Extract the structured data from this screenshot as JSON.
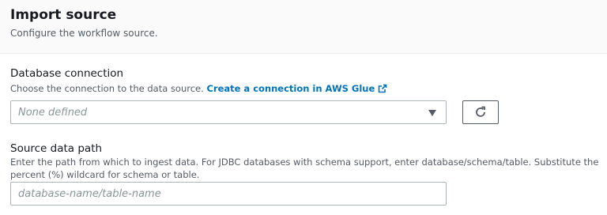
{
  "header": {
    "title": "Import source",
    "description": "Configure the workflow source."
  },
  "database_connection": {
    "label": "Database connection",
    "description": "Choose the connection to the data source.",
    "link_text": "Create a connection in AWS Glue",
    "link_icon": "external-link-icon",
    "selected_value": "None defined",
    "refresh_icon": "refresh-icon"
  },
  "source_path": {
    "label": "Source data path",
    "description": "Enter the path from which to ingest data. For JDBC databases with schema support, enter database/schema/table. Substitute the percent (%) wildcard for schema or table.",
    "placeholder": "database-name/table-name",
    "value": ""
  },
  "colors": {
    "link": "#0073bb",
    "header_bg": "#fafafa",
    "border": "#aab7b8",
    "placeholder": "#879596"
  }
}
